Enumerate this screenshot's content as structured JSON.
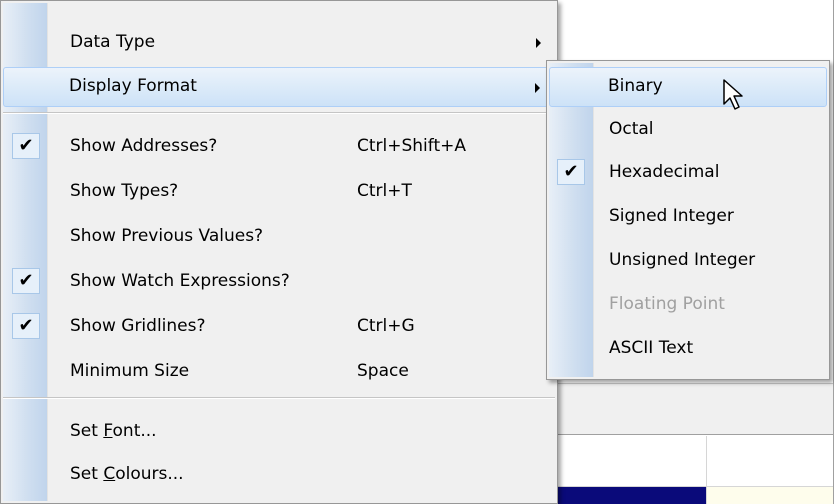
{
  "main_menu": {
    "items": [
      {
        "label": "Data Type",
        "submenu": true
      },
      {
        "label": "Display Format",
        "submenu": true,
        "highlighted": true
      },
      {
        "label": "Show Addresses?",
        "shortcut": "Ctrl+Shift+A",
        "checked": true
      },
      {
        "label": "Show Types?",
        "shortcut": "Ctrl+T",
        "checked": false
      },
      {
        "label": "Show Previous Values?",
        "checked": false
      },
      {
        "label": "Show Watch Expressions?",
        "checked": true
      },
      {
        "label": "Show Gridlines?",
        "shortcut": "Ctrl+G",
        "checked": true
      },
      {
        "label": "Minimum Size",
        "shortcut": "Space",
        "checked": false
      },
      {
        "label_prefix": "Set ",
        "label_mnemonic": "F",
        "label_suffix": "ont..."
      },
      {
        "label_prefix": "Set ",
        "label_mnemonic": "C",
        "label_suffix": "olours..."
      }
    ]
  },
  "display_format_menu": {
    "items": [
      {
        "label": "Binary",
        "highlighted": true
      },
      {
        "label": "Octal"
      },
      {
        "label": "Hexadecimal",
        "checked": true
      },
      {
        "label": "Signed Integer"
      },
      {
        "label": "Unsigned Integer"
      },
      {
        "label": "Floating Point",
        "disabled": true
      },
      {
        "label": "ASCII Text"
      }
    ]
  },
  "check_glyph": "✔",
  "colors": {
    "menu_bg": "#f0f0f0",
    "highlight": "#dcebf9",
    "highlight_border": "#aecff7",
    "disabled_text": "#a0a0a0",
    "bg_selected_cell": "#0a0a7a"
  }
}
